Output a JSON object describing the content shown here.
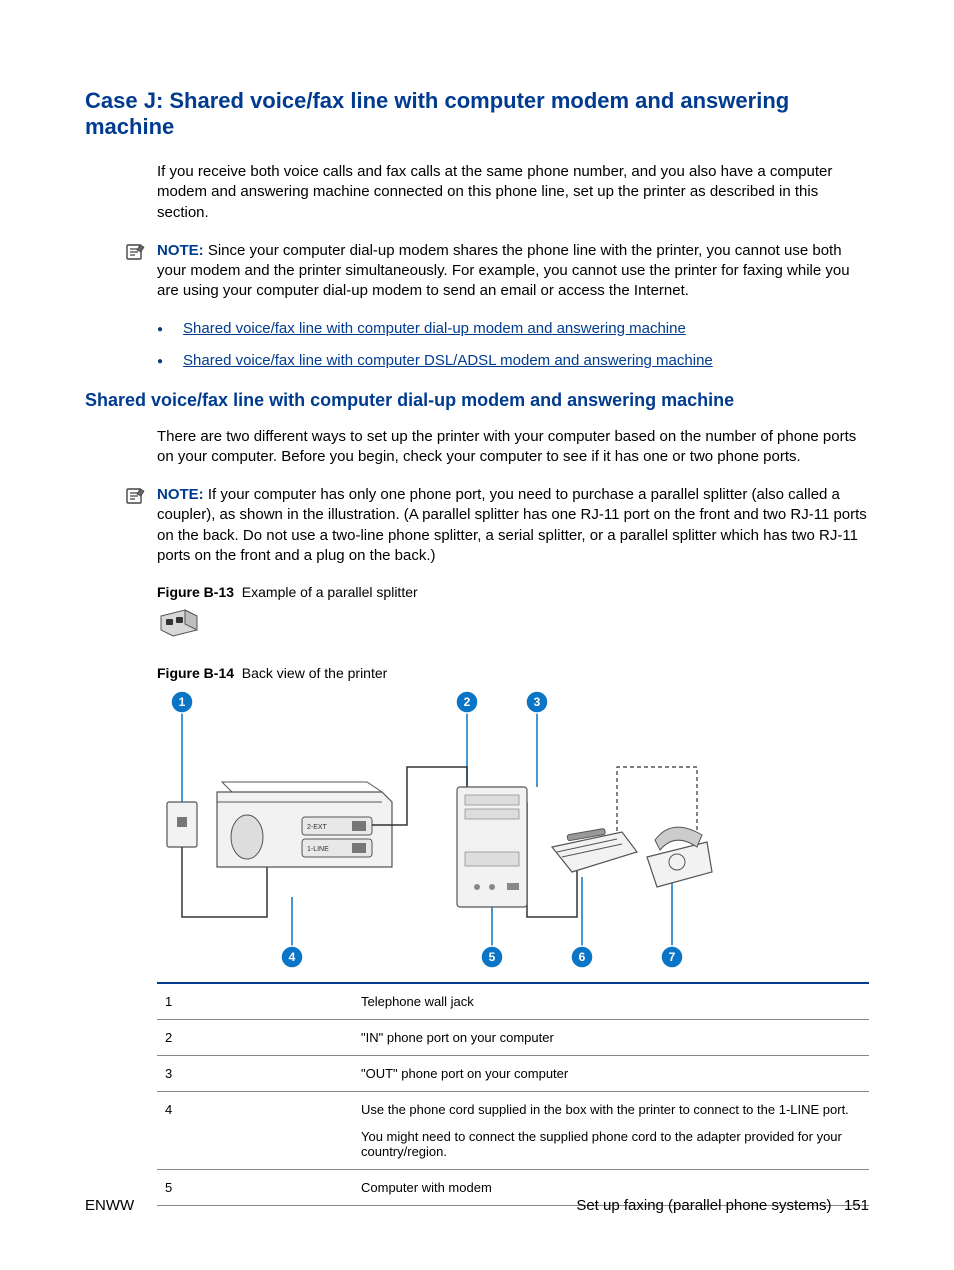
{
  "heading": "Case J: Shared voice/fax line with computer modem and answering machine",
  "intro": "If you receive both voice calls and fax calls at the same phone number, and you also have a computer modem and answering machine connected on this phone line, set up the printer as described in this section.",
  "note1_label": "NOTE:",
  "note1_text": "Since your computer dial-up modem shares the phone line with the printer, you cannot use both your modem and the printer simultaneously. For example, you cannot use the printer for faxing while you are using your computer dial-up modem to send an email or access the Internet.",
  "links": [
    "Shared voice/fax line with computer dial-up modem and answering machine",
    "Shared voice/fax line with computer DSL/ADSL modem and answering machine"
  ],
  "subheading": "Shared voice/fax line with computer dial-up modem and answering machine",
  "subintro": "There are two different ways to set up the printer with your computer based on the number of phone ports on your computer. Before you begin, check your computer to see if it has one or two phone ports.",
  "note2_label": "NOTE:",
  "note2_text": "If your computer has only one phone port, you need to purchase a parallel splitter (also called a coupler), as shown in the illustration. (A parallel splitter has one RJ-11 port on the front and two RJ-11 ports on the back. Do not use a two-line phone splitter, a serial splitter, or a parallel splitter which has two RJ-11 ports on the front and a plug on the back.)",
  "fig13_label": "Figure B-13",
  "fig13_caption": "Example of a parallel splitter",
  "fig14_label": "Figure B-14",
  "fig14_caption": "Back view of the printer",
  "callouts": [
    "1",
    "2",
    "3",
    "4",
    "5",
    "6",
    "7"
  ],
  "port_labels": {
    "ext": "2-EXT",
    "line": "1-LINE"
  },
  "legend": [
    {
      "n": "1",
      "t": "Telephone wall jack"
    },
    {
      "n": "2",
      "t": "\"IN\" phone port on your computer"
    },
    {
      "n": "3",
      "t": "\"OUT\" phone port on your computer"
    },
    {
      "n": "4",
      "t": "Use the phone cord supplied in the box with the printer to connect to the 1-LINE port.",
      "t2": "You might need to connect the supplied phone cord to the adapter provided for your country/region."
    },
    {
      "n": "5",
      "t": "Computer with modem"
    }
  ],
  "footer_left": "ENWW",
  "footer_right": "Set up faxing (parallel phone systems)",
  "page_num": "151"
}
